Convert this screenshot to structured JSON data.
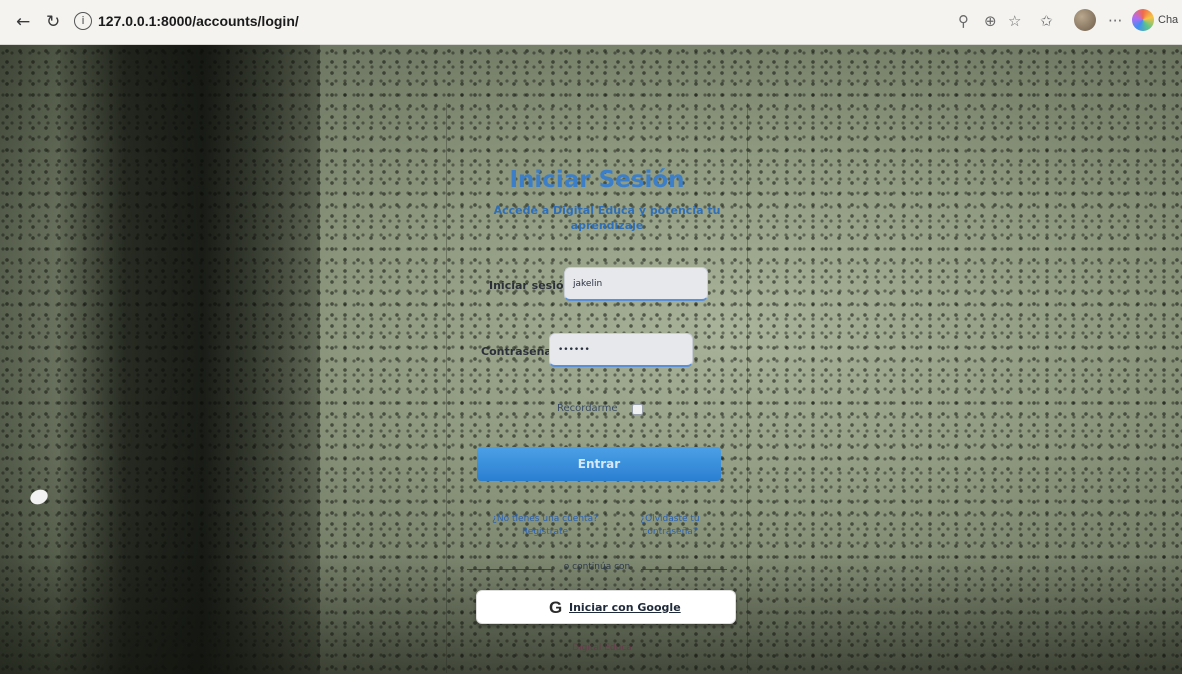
{
  "browser": {
    "back_icon": "arrow-left-icon",
    "reload_icon": "reload-icon",
    "info_icon": "info-icon",
    "url": "127.0.0.1:8000/accounts/login/",
    "toolbar_icons": [
      "search-icon",
      "zoom-icon",
      "favorite-star-icon",
      "favorites-icon",
      "profile-avatar",
      "more-icon",
      "copilot-icon"
    ],
    "copilot_label": "Cha"
  },
  "login": {
    "title": "Iniciar Sesión",
    "subtitle": "Accede a Digital Educa y potencia tu aprendizaje",
    "username_label": "Iniciar sesión:",
    "username_value": "jakelin",
    "password_label": "Contraseña:",
    "password_value": "••••••",
    "remember_label": "Recordarme",
    "remember_checked": false,
    "submit_label": "Entrar",
    "register_prompt": "¿No tienes una cuenta?",
    "register_link": "Regístrate",
    "forgot_link": "¿Olvidaste tu contraseña?",
    "divider_text": "o continúa con",
    "google_icon": "G",
    "google_label": "Iniciar con Google",
    "footer": "Digital Educa"
  },
  "colors": {
    "title": "#3c7fc8",
    "submit_button": "#2f86d8",
    "link": "#2a63b8",
    "google_button": "#ffffff"
  }
}
